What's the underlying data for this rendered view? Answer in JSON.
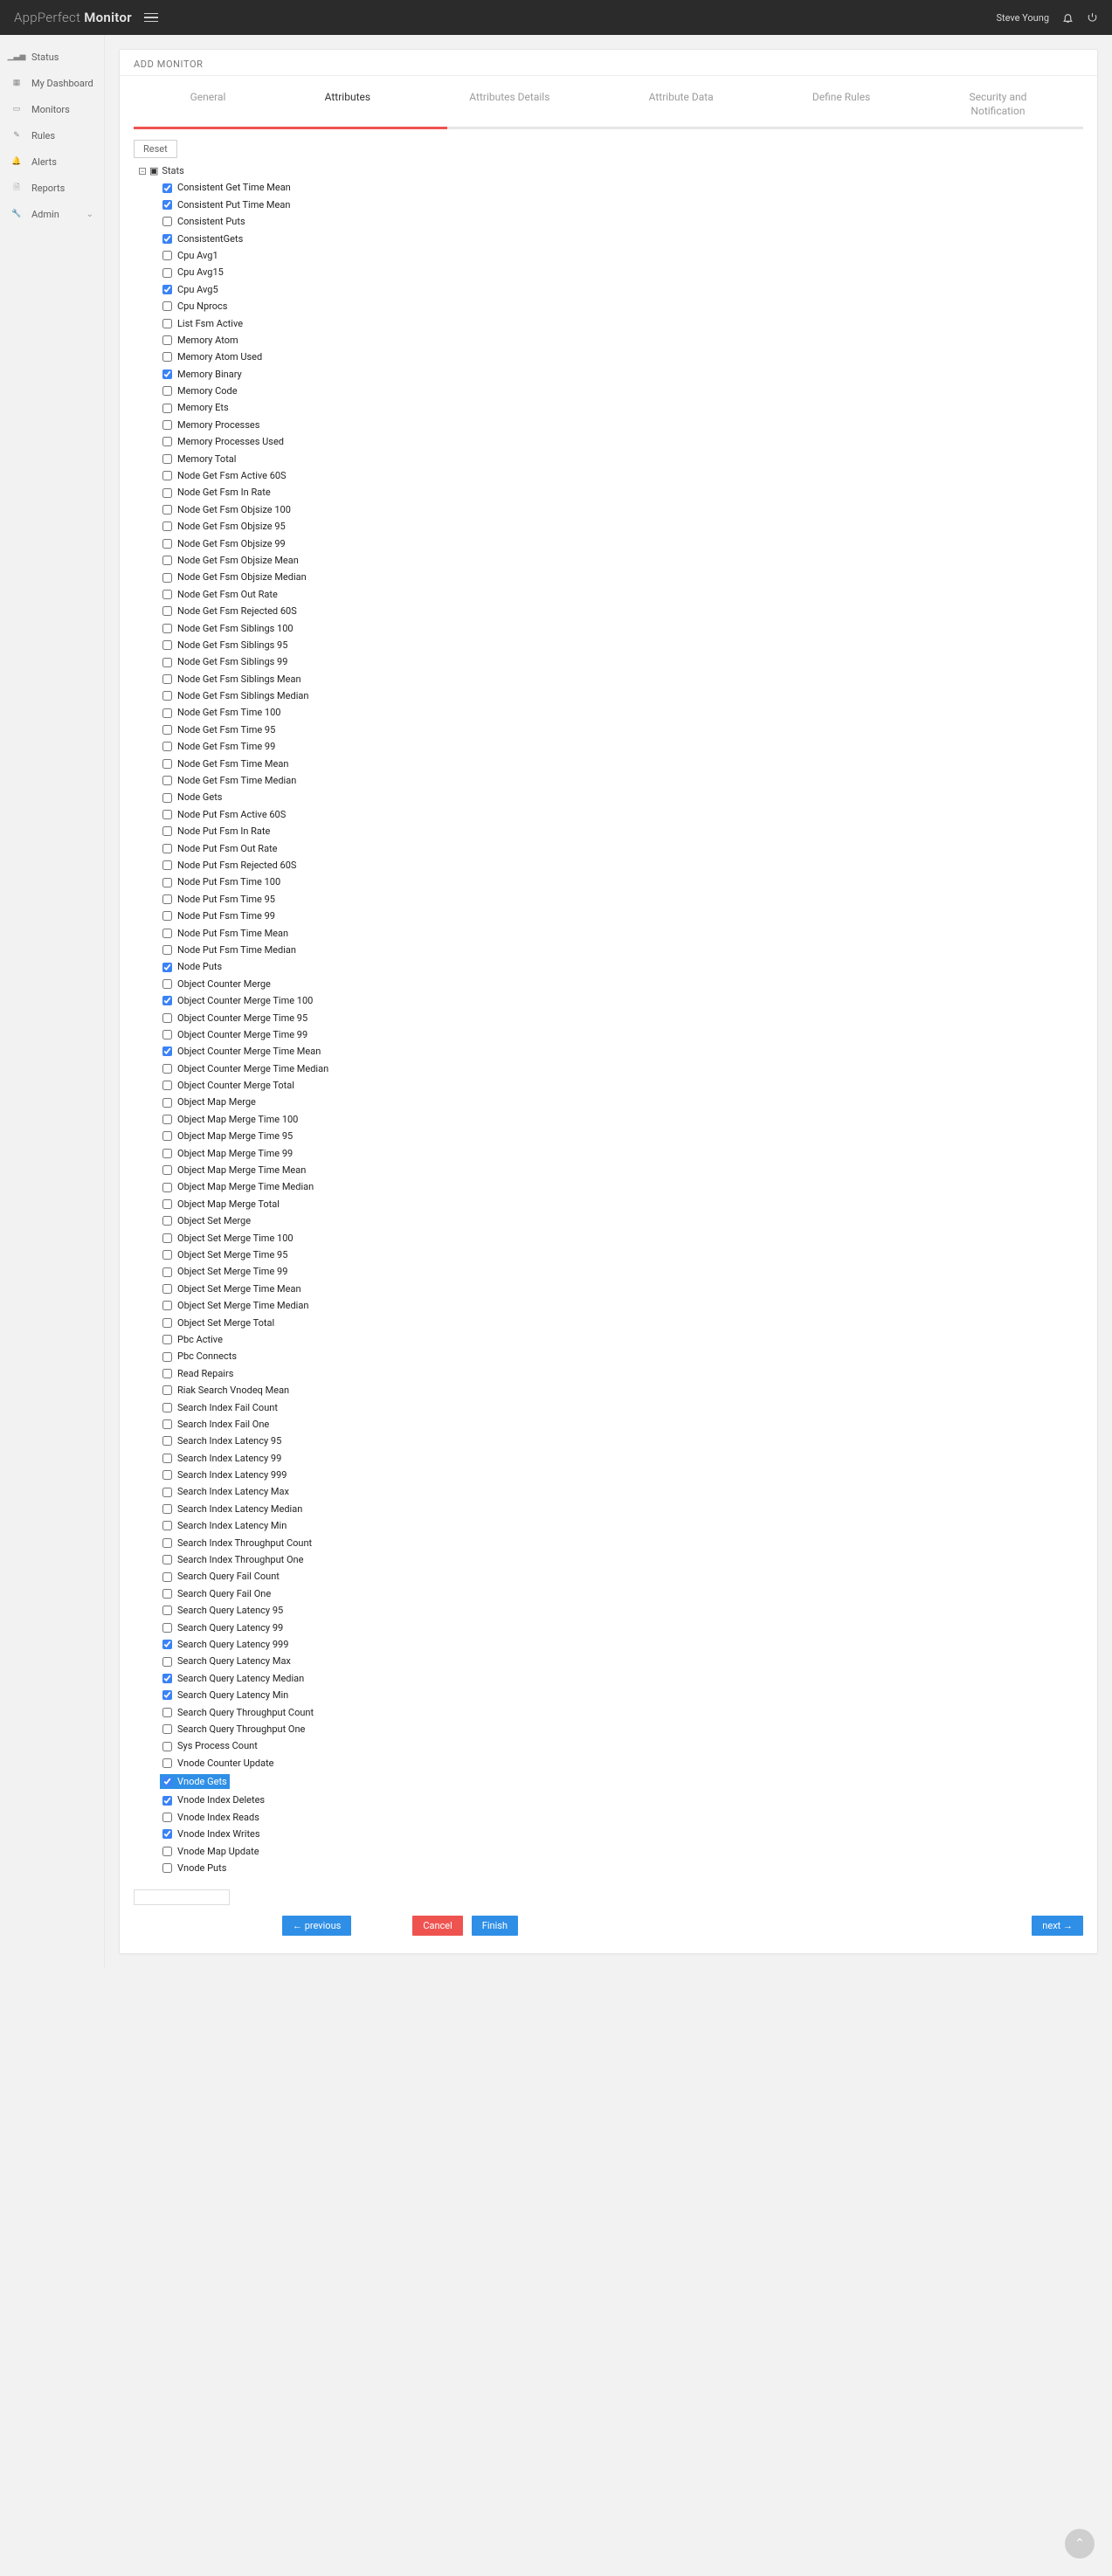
{
  "header": {
    "brand_light": "AppPerfect",
    "brand_bold": "Monitor",
    "user": "Steve Young"
  },
  "sidebar": {
    "items": [
      {
        "label": "Status"
      },
      {
        "label": "My Dashboard"
      },
      {
        "label": "Monitors"
      },
      {
        "label": "Rules"
      },
      {
        "label": "Alerts"
      },
      {
        "label": "Reports"
      },
      {
        "label": "Admin",
        "chev": true
      }
    ]
  },
  "page": {
    "title": "ADD MONITOR",
    "reset": "Reset"
  },
  "tabs": {
    "items": [
      {
        "label": "General"
      },
      {
        "label": "Attributes"
      },
      {
        "label": "Attributes Details"
      },
      {
        "label": "Attribute Data"
      },
      {
        "label": "Define Rules"
      },
      {
        "label": "Security and\nNotification"
      }
    ],
    "active": 1,
    "progress": 33
  },
  "tree": {
    "root": "Stats",
    "nodes": [
      {
        "l": "Consistent Get Time Mean",
        "c": true
      },
      {
        "l": "Consistent Put Time Mean",
        "c": true
      },
      {
        "l": "Consistent Puts",
        "c": false
      },
      {
        "l": "ConsistentGets",
        "c": true
      },
      {
        "l": "Cpu Avg1",
        "c": false
      },
      {
        "l": "Cpu Avg15",
        "c": false
      },
      {
        "l": "Cpu Avg5",
        "c": true
      },
      {
        "l": "Cpu Nprocs",
        "c": false
      },
      {
        "l": "List Fsm Active",
        "c": false
      },
      {
        "l": "Memory Atom",
        "c": false
      },
      {
        "l": "Memory Atom Used",
        "c": false
      },
      {
        "l": "Memory Binary",
        "c": true
      },
      {
        "l": "Memory Code",
        "c": false
      },
      {
        "l": "Memory Ets",
        "c": false
      },
      {
        "l": "Memory Processes",
        "c": false
      },
      {
        "l": "Memory Processes Used",
        "c": false
      },
      {
        "l": "Memory Total",
        "c": false
      },
      {
        "l": "Node Get Fsm Active 60S",
        "c": false
      },
      {
        "l": "Node Get Fsm In Rate",
        "c": false
      },
      {
        "l": "Node Get Fsm Objsize 100",
        "c": false
      },
      {
        "l": "Node Get Fsm Objsize 95",
        "c": false
      },
      {
        "l": "Node Get Fsm Objsize 99",
        "c": false
      },
      {
        "l": "Node Get Fsm Objsize Mean",
        "c": false
      },
      {
        "l": "Node Get Fsm Objsize Median",
        "c": false
      },
      {
        "l": "Node Get Fsm Out Rate",
        "c": false
      },
      {
        "l": "Node Get Fsm Rejected 60S",
        "c": false
      },
      {
        "l": "Node Get Fsm Siblings 100",
        "c": false
      },
      {
        "l": "Node Get Fsm Siblings 95",
        "c": false
      },
      {
        "l": "Node Get Fsm Siblings 99",
        "c": false
      },
      {
        "l": "Node Get Fsm Siblings Mean",
        "c": false
      },
      {
        "l": "Node Get Fsm Siblings Median",
        "c": false
      },
      {
        "l": "Node Get Fsm Time 100",
        "c": false
      },
      {
        "l": "Node Get Fsm Time 95",
        "c": false
      },
      {
        "l": "Node Get Fsm Time 99",
        "c": false
      },
      {
        "l": "Node Get Fsm Time Mean",
        "c": false
      },
      {
        "l": "Node Get Fsm Time Median",
        "c": false
      },
      {
        "l": "Node Gets",
        "c": false
      },
      {
        "l": "Node Put Fsm Active 60S",
        "c": false
      },
      {
        "l": "Node Put Fsm In Rate",
        "c": false
      },
      {
        "l": "Node Put Fsm Out Rate",
        "c": false
      },
      {
        "l": "Node Put Fsm Rejected 60S",
        "c": false
      },
      {
        "l": "Node Put Fsm Time 100",
        "c": false
      },
      {
        "l": "Node Put Fsm Time 95",
        "c": false
      },
      {
        "l": "Node Put Fsm Time 99",
        "c": false
      },
      {
        "l": "Node Put Fsm Time Mean",
        "c": false
      },
      {
        "l": "Node Put Fsm Time Median",
        "c": false
      },
      {
        "l": "Node Puts",
        "c": true
      },
      {
        "l": "Object Counter Merge",
        "c": false
      },
      {
        "l": "Object Counter Merge Time 100",
        "c": true
      },
      {
        "l": "Object Counter Merge Time 95",
        "c": false
      },
      {
        "l": "Object Counter Merge Time 99",
        "c": false
      },
      {
        "l": "Object Counter Merge Time Mean",
        "c": true
      },
      {
        "l": "Object Counter Merge Time Median",
        "c": false
      },
      {
        "l": "Object Counter Merge Total",
        "c": false
      },
      {
        "l": "Object Map Merge",
        "c": false
      },
      {
        "l": "Object Map Merge Time 100",
        "c": false
      },
      {
        "l": "Object Map Merge Time 95",
        "c": false
      },
      {
        "l": "Object Map Merge Time 99",
        "c": false
      },
      {
        "l": "Object Map Merge Time Mean",
        "c": false
      },
      {
        "l": "Object Map Merge Time Median",
        "c": false
      },
      {
        "l": "Object Map Merge Total",
        "c": false
      },
      {
        "l": "Object Set Merge",
        "c": false
      },
      {
        "l": "Object Set Merge Time 100",
        "c": false
      },
      {
        "l": "Object Set Merge Time 95",
        "c": false
      },
      {
        "l": "Object Set Merge Time 99",
        "c": false
      },
      {
        "l": "Object Set Merge Time Mean",
        "c": false
      },
      {
        "l": "Object Set Merge Time Median",
        "c": false
      },
      {
        "l": "Object Set Merge Total",
        "c": false
      },
      {
        "l": "Pbc Active",
        "c": false
      },
      {
        "l": "Pbc Connects",
        "c": false
      },
      {
        "l": "Read Repairs",
        "c": false
      },
      {
        "l": "Riak Search Vnodeq Mean",
        "c": false
      },
      {
        "l": "Search Index Fail Count",
        "c": false
      },
      {
        "l": "Search Index Fail One",
        "c": false
      },
      {
        "l": "Search Index Latency 95",
        "c": false
      },
      {
        "l": "Search Index Latency 99",
        "c": false
      },
      {
        "l": "Search Index Latency 999",
        "c": false
      },
      {
        "l": "Search Index Latency Max",
        "c": false
      },
      {
        "l": "Search Index Latency Median",
        "c": false
      },
      {
        "l": "Search Index Latency Min",
        "c": false
      },
      {
        "l": "Search Index Throughput Count",
        "c": false
      },
      {
        "l": "Search Index Throughput One",
        "c": false
      },
      {
        "l": "Search Query Fail Count",
        "c": false
      },
      {
        "l": "Search Query Fail One",
        "c": false
      },
      {
        "l": "Search Query Latency 95",
        "c": false
      },
      {
        "l": "Search Query Latency 99",
        "c": false
      },
      {
        "l": "Search Query Latency 999",
        "c": true
      },
      {
        "l": "Search Query Latency Max",
        "c": false
      },
      {
        "l": "Search Query Latency Median",
        "c": true
      },
      {
        "l": "Search Query Latency Min",
        "c": true
      },
      {
        "l": "Search Query Throughput Count",
        "c": false
      },
      {
        "l": "Search Query Throughput One",
        "c": false
      },
      {
        "l": "Sys Process Count",
        "c": false
      },
      {
        "l": "Vnode Counter Update",
        "c": false
      },
      {
        "l": "Vnode Gets",
        "c": true,
        "sel": true
      },
      {
        "l": "Vnode Index Deletes",
        "c": true
      },
      {
        "l": "Vnode Index Reads",
        "c": false
      },
      {
        "l": "Vnode Index Writes",
        "c": true
      },
      {
        "l": "Vnode Map Update",
        "c": false
      },
      {
        "l": "Vnode Puts",
        "c": false
      }
    ]
  },
  "buttons": {
    "prev": "← previous",
    "cancel": "Cancel",
    "finish": "Finish",
    "next": "next →"
  }
}
